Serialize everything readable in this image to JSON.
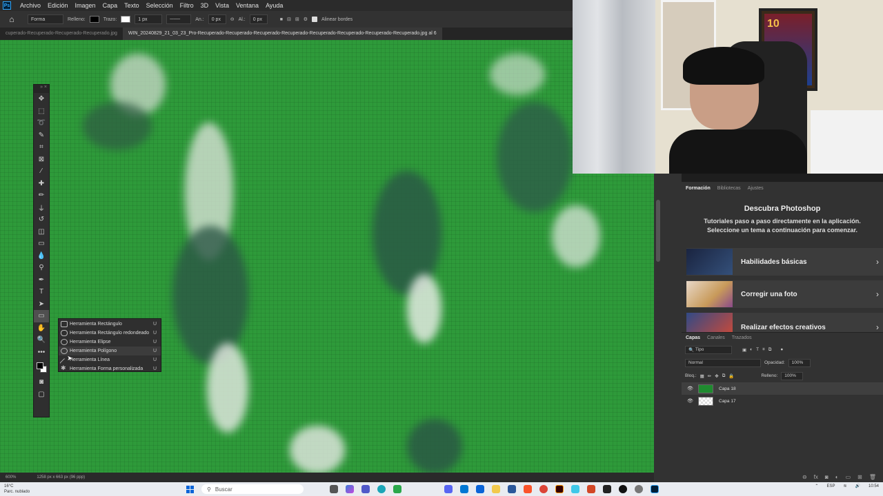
{
  "menubar": {
    "app_icon": "Ps",
    "items": [
      "Archivo",
      "Edición",
      "Imagen",
      "Capa",
      "Texto",
      "Selección",
      "Filtro",
      "3D",
      "Vista",
      "Ventana",
      "Ayuda"
    ]
  },
  "options": {
    "home_icon": "home-icon",
    "mode": "Forma",
    "fill_label": "Relleno:",
    "stroke_label": "Trazo:",
    "stroke_width": "1 px",
    "w_label": "An.:",
    "w_value": "0 px",
    "h_label": "Al.:",
    "h_value": "0 px",
    "align_edges": "Alinear bordes"
  },
  "tabs": [
    "cuperado-Recuperado-Recuperado-Recuperado.jpg",
    "WIN_20240829_21_03_23_Pro-Recuperado-Recuperado-Recuperado-Recuperado-Recuperado-Recuperado-Recuperado-Recuperado.jpg al 6"
  ],
  "flyout": [
    {
      "label": "Herramienta Rectángulo",
      "key": "U"
    },
    {
      "label": "Herramienta Rectángulo redondeado",
      "key": "U"
    },
    {
      "label": "Herramienta Elipse",
      "key": "U"
    },
    {
      "label": "Herramienta Polígono",
      "key": "U"
    },
    {
      "label": "Herramienta Línea",
      "key": "U"
    },
    {
      "label": "Herramienta Forma personalizada",
      "key": "U"
    }
  ],
  "status": {
    "zoom": "600%",
    "doc_info": "1258 px x 663 px (96 ppp)"
  },
  "webcam": {
    "poster_number": "10"
  },
  "learn": {
    "tabs": [
      "Formación",
      "Bibliotecas",
      "Ajustes"
    ],
    "title": "Descubra Photoshop",
    "subtitle_1": "Tutoriales paso a paso directamente en la aplicación.",
    "subtitle_2": "Seleccione un tema a continuación para comenzar.",
    "cards": [
      "Habilidades básicas",
      "Corregir una foto",
      "Realizar efectos creativos"
    ]
  },
  "layers": {
    "tabs": [
      "Capas",
      "Canales",
      "Trazados"
    ],
    "filter": "Tipo",
    "blend_mode": "Normal",
    "opacity_label": "Opacidad:",
    "opacity": "100%",
    "lock_label": "Bloq.:",
    "fill_label": "Relleno:",
    "fill": "100%",
    "items": [
      "Capa 18",
      "Capa 17"
    ]
  },
  "taskbar": {
    "temp": "16°C",
    "weather": "Parc. nublado",
    "search": "Buscar",
    "lang": "ESP",
    "time": "10:54"
  },
  "colors": {
    "canvas_green": "#2e9a3a",
    "accent": "#31a8ff"
  }
}
